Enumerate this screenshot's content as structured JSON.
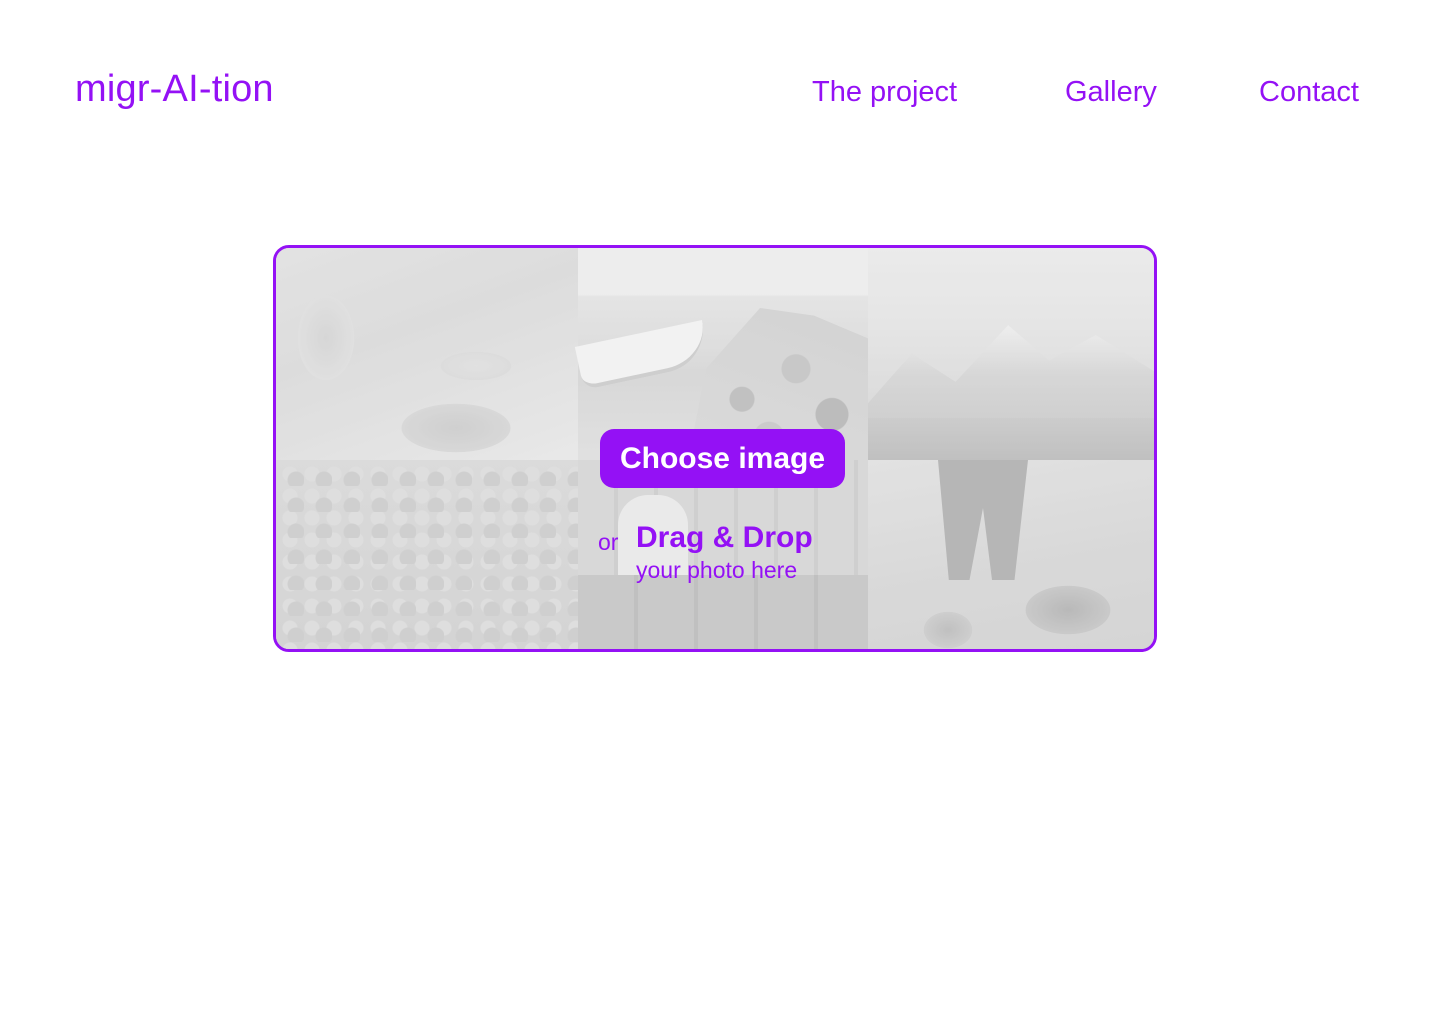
{
  "header": {
    "logo": "migr-AI-tion",
    "nav": [
      {
        "label": "The project"
      },
      {
        "label": "Gallery"
      },
      {
        "label": "Contact"
      }
    ]
  },
  "upload": {
    "button_label": "Choose image",
    "or_label": "or",
    "drag_title": "Drag & Drop",
    "drag_subtitle": "your photo here",
    "background_images": [
      "serving-food-photo",
      "lake-boat-photo",
      "mountains-photo",
      "market-fruits-photo",
      "worker-crates-photo",
      "digging-photo"
    ]
  },
  "colors": {
    "accent": "#9411f5",
    "background": "#ffffff"
  }
}
